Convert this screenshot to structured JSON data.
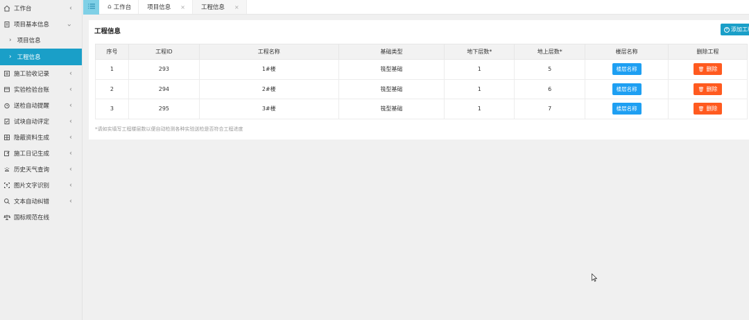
{
  "sidebar": {
    "items": [
      {
        "label": "工作台",
        "icon": "home-icon",
        "chev": "‹"
      },
      {
        "label": "项目基本信息",
        "icon": "clipboard-icon",
        "chev": "⌄"
      },
      {
        "label": "施工验收记录",
        "icon": "record-icon",
        "chev": "‹"
      },
      {
        "label": "实验检验台账",
        "icon": "ledger-icon",
        "chev": "‹"
      },
      {
        "label": "送检自动提醒",
        "icon": "alarm-clock-icon",
        "chev": "‹"
      },
      {
        "label": "试块自动评定",
        "icon": "document-check-icon",
        "chev": "‹"
      },
      {
        "label": "隐蔽资料生成",
        "icon": "grid-icon",
        "chev": "‹"
      },
      {
        "label": "施工日记生成",
        "icon": "edit-doc-icon",
        "chev": "‹"
      },
      {
        "label": "历史天气查询",
        "icon": "weather-icon",
        "chev": "‹"
      },
      {
        "label": "图片文字识别",
        "icon": "text-scan-icon",
        "chev": "‹"
      },
      {
        "label": "文本自动纠错",
        "icon": "magnifier-icon",
        "chev": "‹"
      },
      {
        "label": "国标规范在线",
        "icon": "balance-icon",
        "chev": ""
      }
    ],
    "sub_items": [
      {
        "label": "项目信息",
        "arrow": "›"
      },
      {
        "label": "工程信息",
        "arrow": "›"
      }
    ]
  },
  "tabs": [
    {
      "label": "工作台",
      "home_glyph": "⌂"
    },
    {
      "label": "项目信息",
      "close": "×"
    },
    {
      "label": "工程信息",
      "close": "×"
    }
  ],
  "panel": {
    "title": "工程信息",
    "add_button": "添加工程",
    "add_plus": "+",
    "note": "*请如实填写工程楼层数以便自动检测各种实验送检是否符合工程进度"
  },
  "table": {
    "headers": [
      "序号",
      "工程ID",
      "工程名称",
      "基础类型",
      "地下层数*",
      "地上层数*",
      "楼层名称",
      "删除工程"
    ],
    "rows": [
      {
        "no": "1",
        "id": "293",
        "name": "1#楼",
        "base": "筏型基础",
        "under": "1",
        "above": "5",
        "floor_btn": "楼层名称",
        "del_btn": "删除"
      },
      {
        "no": "2",
        "id": "294",
        "name": "2#楼",
        "base": "筏型基础",
        "under": "1",
        "above": "6",
        "floor_btn": "楼层名称",
        "del_btn": "删除"
      },
      {
        "no": "3",
        "id": "295",
        "name": "3#楼",
        "base": "筏型基础",
        "under": "1",
        "above": "7",
        "floor_btn": "楼层名称",
        "del_btn": "删除"
      }
    ],
    "trash_glyph": "🗑"
  },
  "colors": {
    "accent": "#1a9fc8",
    "blue_button": "#1e9ff2",
    "orange_button": "#ff5a1f",
    "toggle": "#7fd0e6"
  }
}
